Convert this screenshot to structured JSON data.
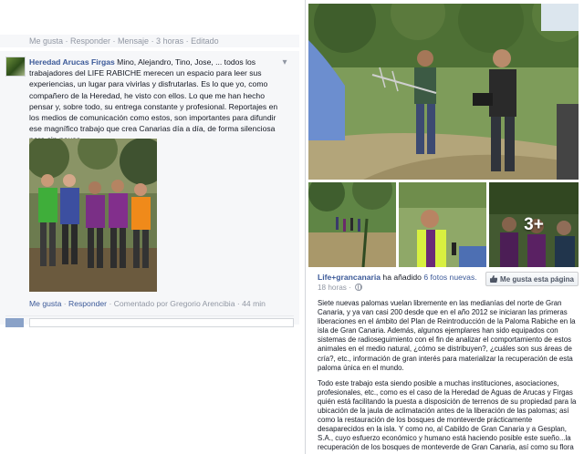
{
  "left": {
    "cut_top_text": "Me gusta · Responder · Mensaje · 3 horas · Editado",
    "comment": {
      "author": "Heredad Arucas Firgas",
      "text": "Mino, Alejandro, Tino, Jose, ... todos los trabajadores del LIFE RABICHE merecen un espacio para leer sus experiencias, un lugar para vivirlas y disfrutarlas. Es lo que yo, como compañero de la Heredad, he visto con ellos. Lo que me han hecho pensar y, sobre todo, su entrega constante y profesional. Reportajes en los medios de comunicación como estos, son importantes para difundir ese magnífico trabajo que crea Canarias día a día, de forma silenciosa pero sin pausa.",
      "like_label": "Me gusta",
      "reply_label": "Responder",
      "commented_by": "Comentado por Gregorio Arencibia",
      "time": "44 min"
    }
  },
  "right": {
    "post": {
      "page_name": "Life+grancanaria",
      "added_text": "ha añadido",
      "new_photos_link": "6 fotos nuevas.",
      "time": "18 horas ·",
      "like_page_label": "Me gusta esta página",
      "more_photos_badge": "3+",
      "paragraphs": [
        "Siete nuevas palomas vuelan libremente en las medianías del norte de Gran Canaria, y ya van casi 200 desde que en el año 2012 se iniciaran las primeras liberaciones en el ámbito del Plan de Reintroducción de la Paloma Rabiche en la isla de Gran Canaria. Además, algunos ejemplares han sido equipados con sistemas de radioseguimiento con el fin de analizar el comportamiento de estos animales en el medio natural, ¿cómo se distribuyen?, ¿cuáles son sus áreas de cría?, etc., información de gran interés para materializar la recuperación de esta paloma única en el mundo.",
        "Todo este trabajo esta siendo posible a muchas instituciones, asociaciones, profesionales, etc., como es el caso de la Heredad de Aguas de Arucas y Firgas quién está facilitando la puesta a disposición de terrenos de su propiedad para la ubicación de la jaula de aclimatación antes de la liberación de las palomas; así como la restauración de los bosques de monteverde prácticamente desaparecidos en la isla. Y como no, al Cabildo de Gran Canaria y a Gesplan, S.A., cuyo esfuerzo económico y humano está haciendo posible este sueño...la recuperación de los bosques de monteverde de Gran Canaria, así como su flora y fauna asociada!!. Gracias a todos los que hacen posible este proyecto."
      ]
    }
  },
  "colors": {
    "link_blue": "#3b5998",
    "meta_gray": "#9197a3",
    "panel_bg": "#f6f7f9"
  }
}
